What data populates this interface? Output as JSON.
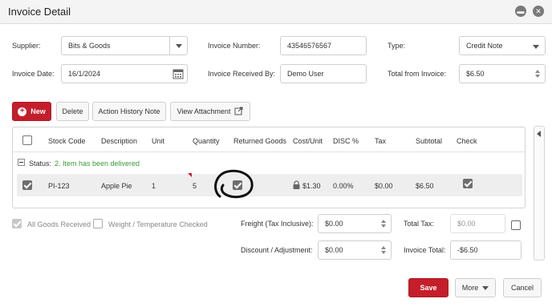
{
  "window": {
    "title": "Invoice Detail"
  },
  "form": {
    "supplier_label": "Supplier:",
    "supplier_value": "Bits & Goods",
    "invoice_number_label": "Invoice Number:",
    "invoice_number_value": "43546576567",
    "type_label": "Type:",
    "type_value": "Credit Note",
    "invoice_date_label": "Invoice Date:",
    "invoice_date_value": "16/1/2024",
    "received_by_label": "Invoice Received By:",
    "received_by_value": "Demo User",
    "total_from_invoice_label": "Total from Invoice:",
    "total_from_invoice_value": "$6.50"
  },
  "toolbar": {
    "new_label": "New",
    "delete_label": "Delete",
    "action_history_label": "Action History Note",
    "view_attachment_label": "View Attachment"
  },
  "grid": {
    "columns": [
      "Stock Code",
      "Description",
      "Unit",
      "Quantity",
      "Returned Goods",
      "Cost/Unit",
      "DISC %",
      "Tax",
      "Subtotal",
      "Check"
    ],
    "group_label": "Status: ",
    "group_value": "2. Item has been delivered",
    "row": {
      "stock_code": "PI-123",
      "description": "Apple Pie",
      "unit": "1",
      "quantity": "5",
      "cost_unit": "$1.30",
      "disc": "0.00%",
      "tax": "$0.00",
      "subtotal": "$6.50"
    }
  },
  "footer": {
    "all_goods_received_label": "All Goods Received",
    "weight_temp_label": "Weight / Temperature Checked",
    "freight_label": "Freight (Tax Inclusive):",
    "freight_value": "$0.00",
    "discount_label": "Discount / Adjustment:",
    "discount_value": "$0.00",
    "total_tax_label": "Total Tax:",
    "total_tax_value": "$0.00",
    "invoice_total_label": "Invoice Total:",
    "invoice_total_value": "-$6.50"
  },
  "actions": {
    "save_label": "Save",
    "more_label": "More",
    "cancel_label": "Cancel"
  },
  "colors": {
    "accent": "#c41e2a",
    "status_green": "#3a9a3a"
  },
  "icons": [
    "minimize-icon",
    "close-icon",
    "calendar-icon",
    "plus-circle-icon",
    "external-link-icon",
    "lock-icon",
    "collapse-icon",
    "caret-left-icon"
  ]
}
